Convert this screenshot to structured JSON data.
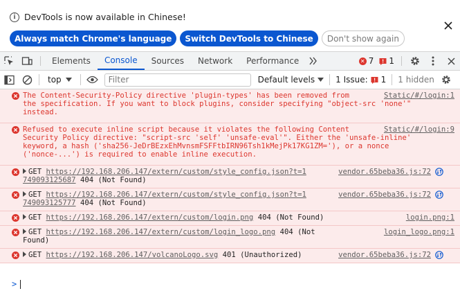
{
  "infobar": {
    "message": "DevTools is now available in Chinese!",
    "buttons": {
      "match_language": "Always match Chrome's language",
      "switch_chinese": "Switch DevTools to Chinese",
      "dont_show": "Don't show again"
    }
  },
  "tabs": {
    "items": [
      "Elements",
      "Console",
      "Sources",
      "Network",
      "Performance"
    ],
    "active": "Console",
    "error_count": "7",
    "issue_count": "1"
  },
  "toolbar": {
    "context": "top",
    "filter_placeholder": "Filter",
    "levels": "Default levels",
    "issues_label": "1 Issue:",
    "issues_count": "1",
    "hidden": "1 hidden"
  },
  "messages": [
    {
      "lines": [
        "The Content-Security-Policy directive 'plugin-types' has been removed from",
        "the specification. If you want to block plugins, consider specifying \"object-src 'none'\"",
        "instead."
      ],
      "source": "Static/#/login:1"
    },
    {
      "lines": [
        "Refused to execute inline script because it violates the following Content",
        "Security Policy directive: \"script-src 'self' 'unsafe-eval'\". Either the 'unsafe-inline'",
        "keyword, a hash ('sha256-JeDrBEzxEhMvnsmFSFFtbIRN96Tsh1kMejPk17KG1ZM='), or a nonce",
        "('nonce-...') is required to enable inline execution."
      ],
      "source": "Static/#/login:9"
    }
  ],
  "network": [
    {
      "method": "GET",
      "url": "https://192.168.206.147/extern/custom/style_config.json?t=1",
      "url2": "749093125687",
      "status": "404 (Not Found)",
      "source": "vendor.65beba36.js:72",
      "wrap": true
    },
    {
      "method": "GET",
      "url": "https://192.168.206.147/extern/custom/style_config.json?t=1",
      "url2": "749093125777",
      "status": "404 (Not Found)",
      "source": "vendor.65beba36.js:72",
      "wrap": true
    },
    {
      "method": "GET",
      "url": "https://192.168.206.147/extern/custom/login.png",
      "status": "404 (Not Found)",
      "source": "login.png:1",
      "wrap": false
    },
    {
      "method": "GET",
      "url": "https://192.168.206.147/extern/custom/login_logo.png",
      "status": "404 (Not",
      "status2": "Found)",
      "source": "login_logo.png:1",
      "wrap": false
    },
    {
      "method": "GET",
      "url": "https://192.168.206.147/volcanoLogo.svg",
      "status": "401 (Unauthorized)",
      "source": "vendor.65beba36.js:72",
      "wrap": false
    }
  ]
}
